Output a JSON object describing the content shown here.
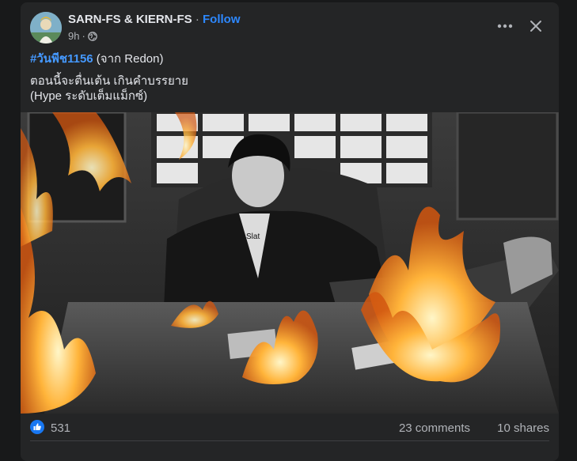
{
  "post": {
    "author": "SARN-FS & KIERN-FS",
    "separator": "·",
    "follow_label": "Follow",
    "time": "9h",
    "hashtag": "#วันพีช1156",
    "hashtag_suffix": " (จาก Redon)",
    "body_lines": [
      "ตอนนี้จะตื่นเต้น เกินคำบรรยาย",
      "(Hype ระดับเต็มแม็กซ์)"
    ]
  },
  "image": {
    "shirt_text": "Slat"
  },
  "stats": {
    "like_count": "531",
    "comments": "23 comments",
    "shares": "10 shares"
  },
  "colors": {
    "link": "#2d88ff",
    "hashtag": "#4599ff",
    "card_bg": "#242526",
    "page_bg": "#18191a",
    "like_blue": "#1877f2"
  },
  "icons": [
    "globe-icon",
    "more-icon",
    "close-icon",
    "like-icon"
  ]
}
